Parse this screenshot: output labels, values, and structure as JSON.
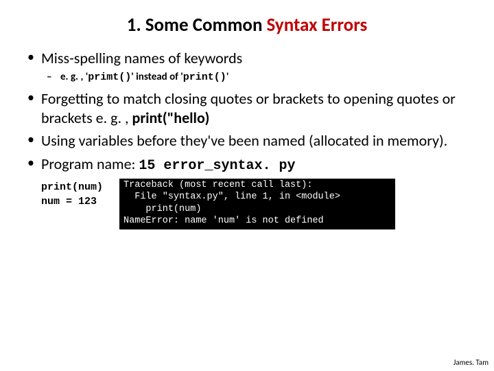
{
  "title": {
    "prefix": "1.  Some Common ",
    "emphasis": "Syntax Errors"
  },
  "bullets": {
    "b1": "Miss-spelling names of keywords",
    "b1sub": {
      "prefix": "e. g. , '",
      "code1": "primt()",
      "mid": "' instead of '",
      "code2": "print()",
      "suffix": "'"
    },
    "b2": {
      "text": "Forgetting to match closing quotes or brackets to opening quotes or brackets e. g. , ",
      "bold": "print(\"hello)"
    },
    "b3": "Using variables before they've been named (allocated in memory).",
    "b4": {
      "text": "Program name: ",
      "code": "15 error_syntax. py"
    }
  },
  "code_block": "print(num)\nnum = 123",
  "terminal_block": "Traceback (most recent call last):\n  File \"syntax.py\", line 1, in <module>\n    print(num)\nNameError: name 'num' is not defined",
  "footer": "James. Tam"
}
